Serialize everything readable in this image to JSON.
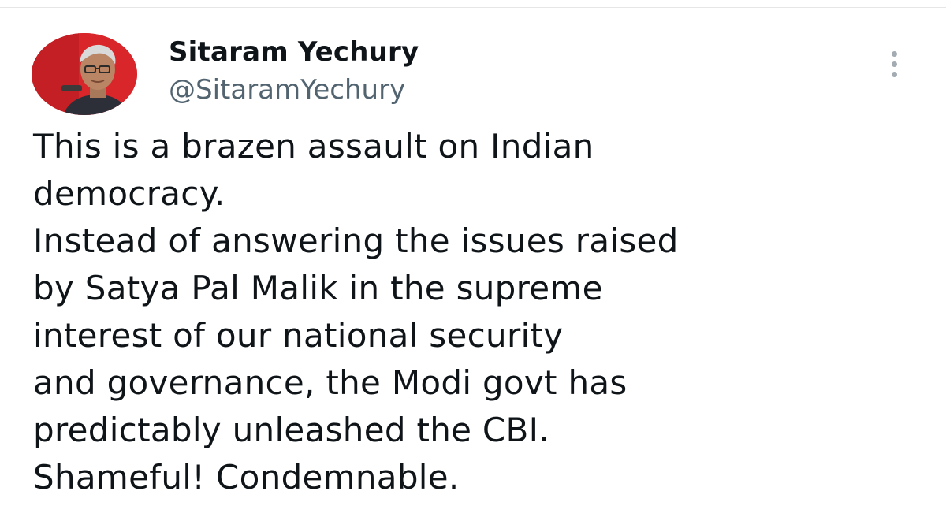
{
  "tweet": {
    "author": {
      "display_name": "Sitaram Yechury",
      "handle": "@SitaramYechury",
      "avatar_background": "#d8262b"
    },
    "more_icon": "more-vertical-icon",
    "text_lines": [
      "This is a brazen assault on Indian",
      "democracy.",
      "Instead of answering the issues raised",
      "by Satya Pal Malik in the supreme",
      "interest of our national security",
      "and governance, the Modi govt has",
      "predictably unleashed the CBI.",
      "Shameful! Condemnable."
    ]
  },
  "colors": {
    "text": "#0f1419",
    "secondary_text": "#536471",
    "icon": "#a3abb3"
  }
}
